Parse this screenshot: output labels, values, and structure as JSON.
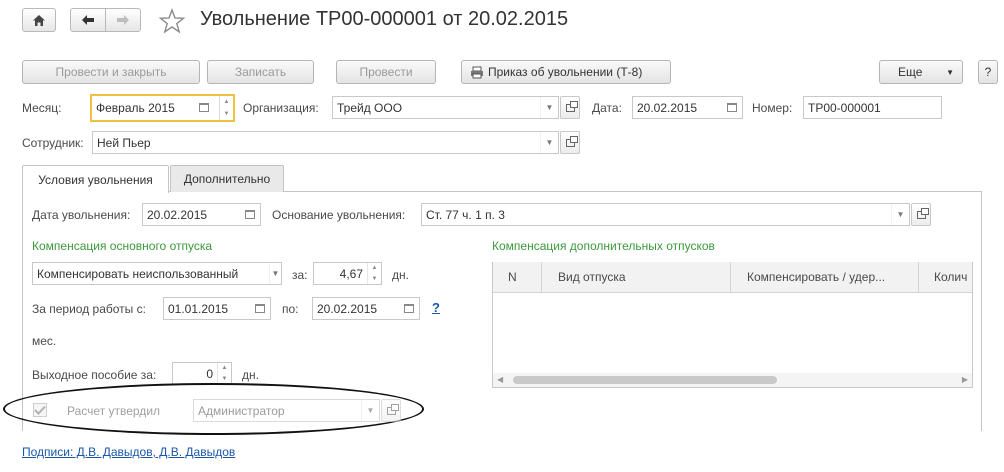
{
  "window": {
    "title": "Увольнение ТР00-000001 от 20.02.2015"
  },
  "toolbar": {
    "post_close_label": "Провести и закрыть",
    "save_label": "Записать",
    "post_label": "Провести",
    "print_label": "Приказ об увольнении (Т-8)",
    "more_label": "Еще",
    "help_label": "?"
  },
  "header_fields": {
    "month_label": "Месяц:",
    "month_value": "Февраль 2015",
    "org_label": "Организация:",
    "org_value": "Трейд ООО",
    "date_label": "Дата:",
    "date_value": "20.02.2015",
    "number_label": "Номер:",
    "number_value": "ТР00-000001",
    "employee_label": "Сотрудник:",
    "employee_value": "Ней Пьер"
  },
  "tabs": [
    {
      "label": "Условия увольнения",
      "active": true
    },
    {
      "label": "Дополнительно",
      "active": false
    }
  ],
  "dismissal": {
    "date_label": "Дата увольнения:",
    "date_value": "20.02.2015",
    "reason_label": "Основание увольнения:",
    "reason_value": "Ст. 77 ч. 1 п. 3"
  },
  "main_leave": {
    "section_title": "Компенсация основного отпуска",
    "mode_value": "Компенсировать неиспользованный",
    "for_label": "за:",
    "days_value": "4,67",
    "days_unit": "дн.",
    "period_label": "За период работы с:",
    "period_from": "01.01.2015",
    "period_to_label": "по:",
    "period_to": "20.02.2015",
    "help_link": "?",
    "months_unit": "мес.",
    "severance_label": "Выходное пособие за:",
    "severance_value": "0",
    "severance_unit": "дн."
  },
  "extra_leave": {
    "section_title": "Компенсация дополнительных отпусков",
    "columns": [
      "N",
      "Вид отпуска",
      "Компенсировать / удер...",
      "Колич"
    ]
  },
  "approval": {
    "label": "Расчет утвердил",
    "checked": true,
    "value": "Администратор"
  },
  "signatures": {
    "link_text": "Подписи: Д.В. Давыдов, Д.В. Давыдов"
  },
  "colors": {
    "section_green": "#3b9a3b",
    "focus_border": "#f0c040",
    "link_blue": "#1a56a8"
  }
}
